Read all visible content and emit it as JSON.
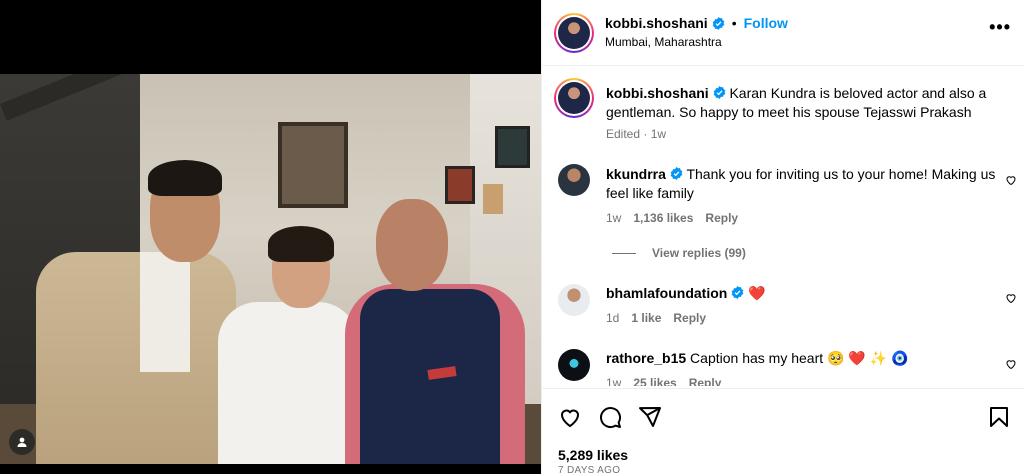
{
  "post": {
    "username": "kobbi.shoshani",
    "follow_label": "Follow",
    "dot": "•",
    "location": "Mumbai, Maharashtra",
    "more": "•••"
  },
  "caption": {
    "username": "kobbi.shoshani",
    "text": "Karan Kundra is beloved actor and also a gentleman. So happy to meet his spouse Tejasswi Prakash",
    "meta": "Edited · 1w"
  },
  "comments": [
    {
      "username": "kkundrra",
      "text": "Thank you for inviting us to your home! Making us feel like family",
      "time": "1w",
      "likes": "1,136 likes",
      "reply": "Reply",
      "view_replies": "View replies (99)"
    },
    {
      "username": "bhamlafoundation",
      "text": "❤️",
      "time": "1d",
      "likes": "1 like",
      "reply": "Reply"
    },
    {
      "username": "rathore_b15",
      "text": "Caption has my heart 🥺 ❤️ ✨ 🧿",
      "time": "1w",
      "likes": "25 likes",
      "reply": "Reply"
    }
  ],
  "footer": {
    "likes": "5,289 likes",
    "ago": "7 DAYS AGO"
  },
  "colors": {
    "link": "#0095f6",
    "muted": "#737373",
    "verified": "#0095f6"
  },
  "icons": [
    "heart-icon",
    "comment-icon",
    "share-icon",
    "bookmark-icon",
    "verified-icon",
    "user-tag-icon",
    "more-options-icon"
  ]
}
